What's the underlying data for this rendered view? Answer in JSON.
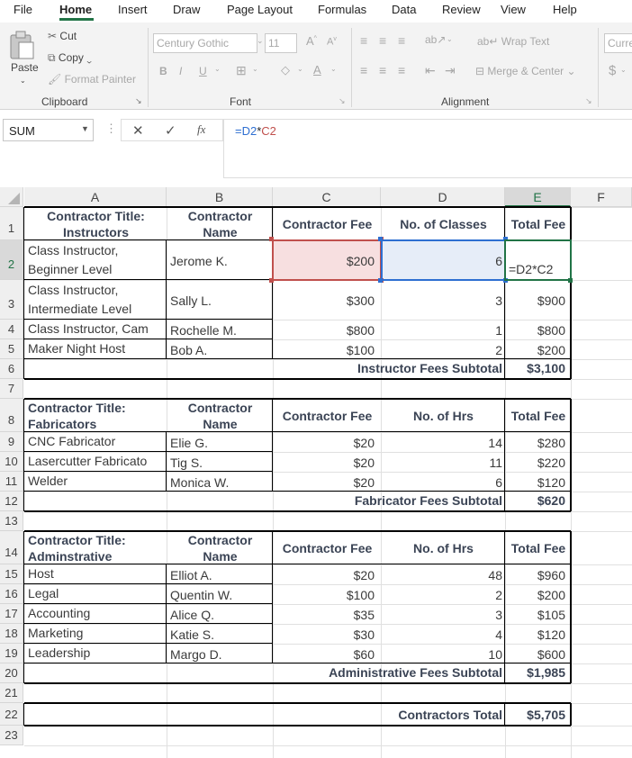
{
  "menu": {
    "tabs": [
      "File",
      "Home",
      "Insert",
      "Draw",
      "Page Layout",
      "Formulas",
      "Data",
      "Review",
      "View",
      "Help"
    ]
  },
  "ribbon": {
    "clipboard": {
      "paste": "Paste",
      "cut": "Cut",
      "copy": "Copy",
      "format_painter": "Format Painter",
      "label": "Clipboard"
    },
    "font": {
      "name": "Century Gothic",
      "size": "11",
      "bold": "B",
      "italic": "I",
      "underline": "U",
      "label": "Font"
    },
    "alignment": {
      "wrap_text": "Wrap Text",
      "merge_center": "Merge & Center",
      "label": "Alignment"
    },
    "number": {
      "format": "Curre",
      "currency": "$"
    }
  },
  "formula_bar": {
    "name_box": "SUM",
    "fx": "fx",
    "formula_ref1": "=D2",
    "formula_op": "*",
    "formula_ref2": "C2"
  },
  "columns": [
    "A",
    "B",
    "C",
    "D",
    "E",
    "F"
  ],
  "rows": [
    "1",
    "2",
    "3",
    "4",
    "5",
    "6",
    "7",
    "8",
    "9",
    "10",
    "11",
    "12",
    "13",
    "14",
    "15",
    "16",
    "17",
    "18",
    "19",
    "20",
    "21",
    "22",
    "23"
  ],
  "sheet": {
    "instructors": {
      "headers": [
        "Contractor Title: Instructors",
        "Contractor Name",
        "Contractor Fee",
        "No. of Classes",
        "Total Fee"
      ],
      "rows": [
        {
          "title": "Class Instructor, Beginner Level",
          "name": "Jerome K.",
          "fee": "$200",
          "qty": "6",
          "total": "=D2*C2"
        },
        {
          "title": "Class Instructor, Intermediate Level",
          "name": "Sally L.",
          "fee": "$300",
          "qty": "3",
          "total": "$900"
        },
        {
          "title": "Class Instructor, Cam",
          "name": "Rochelle M.",
          "fee": "$800",
          "qty": "1",
          "total": "$800"
        },
        {
          "title": "Maker Night Host",
          "name": "Bob A.",
          "fee": "$100",
          "qty": "2",
          "total": "$200"
        }
      ],
      "subtotal_label": "Instructor Fees Subtotal",
      "subtotal": "$3,100"
    },
    "fabricators": {
      "headers": [
        "Contractor Title: Fabricators",
        "Contractor Name",
        "Contractor Fee",
        "No. of Hrs",
        "Total Fee"
      ],
      "rows": [
        {
          "title": "CNC Fabricator",
          "name": "Elie G.",
          "fee": "$20",
          "qty": "14",
          "total": "$280"
        },
        {
          "title": "Lasercutter Fabricato",
          "name": "Tig S.",
          "fee": "$20",
          "qty": "11",
          "total": "$220"
        },
        {
          "title": "Welder",
          "name": "Monica W.",
          "fee": "$20",
          "qty": "6",
          "total": "$120"
        }
      ],
      "subtotal_label": "Fabricator Fees Subtotal",
      "subtotal": "$620"
    },
    "administrative": {
      "headers": [
        "Contractor Title: Adminstrative",
        "Contractor Name",
        "Contractor Fee",
        "No. of Hrs",
        "Total Fee"
      ],
      "rows": [
        {
          "title": "Host",
          "name": "Elliot A.",
          "fee": "$20",
          "qty": "48",
          "total": "$960"
        },
        {
          "title": "Legal",
          "name": "Quentin W.",
          "fee": "$100",
          "qty": "2",
          "total": "$200"
        },
        {
          "title": "Accounting",
          "name": "Alice Q.",
          "fee": "$35",
          "qty": "3",
          "total": "$105"
        },
        {
          "title": "Marketing",
          "name": "Katie S.",
          "fee": "$30",
          "qty": "4",
          "total": "$120"
        },
        {
          "title": "Leadership",
          "name": "Margo D.",
          "fee": "$60",
          "qty": "10",
          "total": "$600"
        }
      ],
      "subtotal_label": "Administrative Fees Subtotal",
      "subtotal": "$1,985"
    },
    "grand_total_label": "Contractors Total",
    "grand_total": "$5,705"
  },
  "colors": {
    "accent": "#217346",
    "ref_red": "#c0504d",
    "ref_blue": "#2e6fd1",
    "header_text": "#3b4455"
  }
}
